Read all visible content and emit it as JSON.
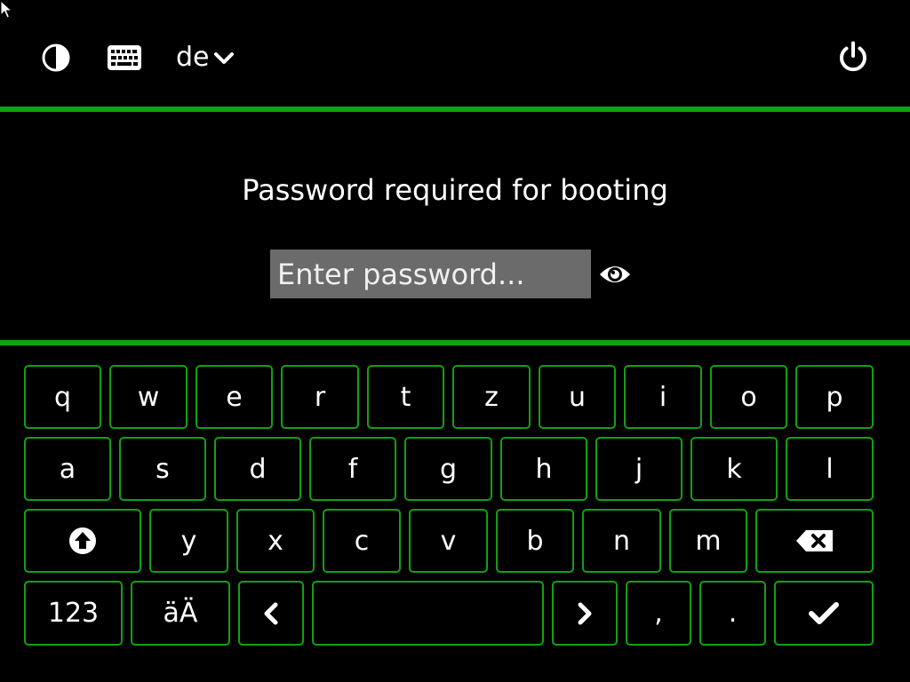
{
  "topbar": {
    "contrast_icon": "contrast-icon",
    "keyboard_icon": "keyboard-icon",
    "language": "de",
    "language_chevron_icon": "chevron-down-icon",
    "power_icon": "power-icon"
  },
  "prompt": {
    "title": "Password required for booting"
  },
  "password": {
    "value": "",
    "placeholder": "Enter password...",
    "toggle_icon": "eye-icon"
  },
  "keyboard": {
    "row1": [
      "q",
      "w",
      "e",
      "r",
      "t",
      "z",
      "u",
      "i",
      "o",
      "p"
    ],
    "row2": [
      "a",
      "s",
      "d",
      "f",
      "g",
      "h",
      "j",
      "k",
      "l"
    ],
    "shift_icon": "shift-icon",
    "row3": [
      "y",
      "x",
      "c",
      "v",
      "b",
      "n",
      "m"
    ],
    "backspace_icon": "backspace-icon",
    "numbers_label": "123",
    "special_label": "äÄ",
    "left_icon": "chevron-left-icon",
    "right_icon": "chevron-right-icon",
    "comma": ",",
    "period": ".",
    "enter_icon": "checkmark-icon"
  },
  "colors": {
    "background": "#000000",
    "accent": "#0ea40e",
    "input_bg": "#6b6b6b",
    "text": "#ffffff"
  }
}
